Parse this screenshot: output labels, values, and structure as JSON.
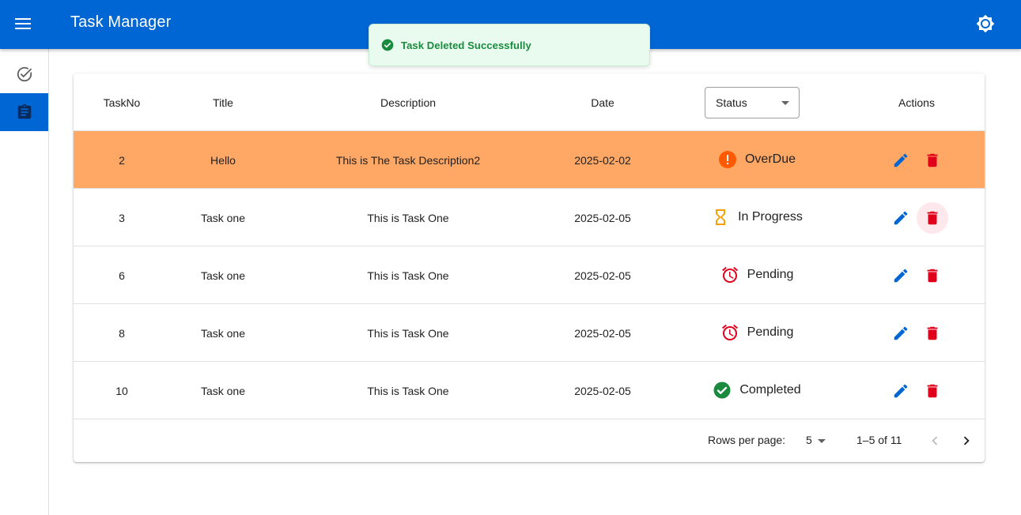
{
  "app": {
    "title": "Task Manager"
  },
  "toast": {
    "message": "Task Deleted Successfully"
  },
  "table": {
    "columns": [
      "TaskNo",
      "Title",
      "Description",
      "Date",
      "Status",
      "Actions"
    ],
    "status_filter_label": "Status",
    "rows": [
      {
        "task_no": "2",
        "title": "Hello",
        "description": "This is The Task Description2",
        "date": "2025-02-02",
        "status": "OverDue"
      },
      {
        "task_no": "3",
        "title": "Task one",
        "description": "This is Task One",
        "date": "2025-02-05",
        "status": "In Progress"
      },
      {
        "task_no": "6",
        "title": "Task one",
        "description": "This is Task One",
        "date": "2025-02-05",
        "status": "Pending"
      },
      {
        "task_no": "8",
        "title": "Task one",
        "description": "This is Task One",
        "date": "2025-02-05",
        "status": "Pending"
      },
      {
        "task_no": "10",
        "title": "Task one",
        "description": "This is Task One",
        "date": "2025-02-05",
        "status": "Completed"
      }
    ]
  },
  "pagination": {
    "rows_per_page_label": "Rows per page:",
    "rows_per_page": "5",
    "range": "1–5 of 11"
  },
  "colors": {
    "primary": "#0066d4",
    "overdue_row": "#ffa866",
    "edit": "#0066d4",
    "delete": "#e0001b",
    "completed": "#1a8b3e",
    "in_progress": "#f5a000",
    "pending": "#e0001b",
    "overdue": "#ff5a00"
  }
}
